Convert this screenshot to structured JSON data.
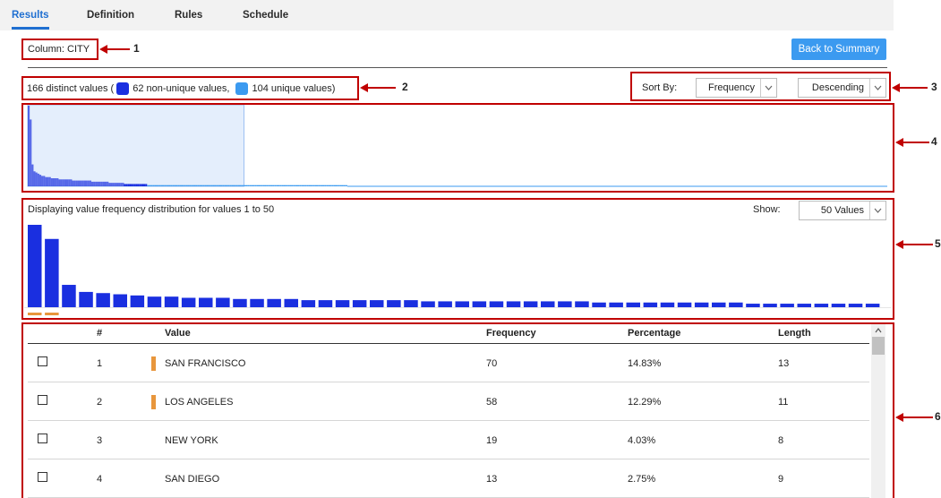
{
  "tabs": [
    {
      "label": "Results",
      "active": true
    },
    {
      "label": "Definition",
      "active": false
    },
    {
      "label": "Rules",
      "active": false
    },
    {
      "label": "Schedule",
      "active": false
    }
  ],
  "column_label": "Column: CITY",
  "back_button": "Back to Summary",
  "summary": {
    "prefix": "166 distinct values (",
    "nonunique_text": "62 non-unique values,",
    "unique_text": "104 unique values)"
  },
  "sort": {
    "label": "Sort By:",
    "by_value": "Frequency",
    "order_value": "Descending"
  },
  "distribution_label": "Displaying value frequency distribution for values 1 to 50",
  "show": {
    "label": "Show:",
    "value": "50 Values"
  },
  "callouts": [
    "1",
    "2",
    "3",
    "4",
    "5",
    "6"
  ],
  "colors": {
    "accent": "#1f6fd1",
    "button": "#3b9af0",
    "non_unique": "#1a2fe0",
    "unique": "#3b9af0",
    "bar": "#1a2fe0",
    "highlight": "#e8963c",
    "annotation": "#c00000"
  },
  "chart_data": {
    "type": "bar",
    "overview_note": "frequencies of all 166 values, descending",
    "top50_values": [
      70,
      58,
      19,
      13,
      12,
      11,
      10,
      9,
      9,
      8,
      8,
      8,
      7,
      7,
      7,
      7,
      6,
      6,
      6,
      6,
      6,
      6,
      6,
      5,
      5,
      5,
      5,
      5,
      5,
      5,
      5,
      5,
      5,
      4,
      4,
      4,
      4,
      4,
      4,
      4,
      4,
      4,
      3,
      3,
      3,
      3,
      3,
      3,
      3,
      3
    ],
    "highlighted_indices": [
      0,
      1
    ],
    "non_unique_count": 62,
    "unique_count": 104,
    "ylim": [
      0,
      70
    ]
  },
  "table": {
    "headers": [
      "#",
      "Value",
      "Frequency",
      "Percentage",
      "Length"
    ],
    "rows": [
      {
        "num": "1",
        "value": "SAN FRANCISCO",
        "frequency": "70",
        "percentage": "14.83%",
        "length": "13",
        "highlighted": true
      },
      {
        "num": "2",
        "value": "LOS ANGELES",
        "frequency": "58",
        "percentage": "12.29%",
        "length": "11",
        "highlighted": true
      },
      {
        "num": "3",
        "value": "NEW YORK",
        "frequency": "19",
        "percentage": "4.03%",
        "length": "8",
        "highlighted": false
      },
      {
        "num": "4",
        "value": "SAN DIEGO",
        "frequency": "13",
        "percentage": "2.75%",
        "length": "9",
        "highlighted": false
      }
    ]
  }
}
